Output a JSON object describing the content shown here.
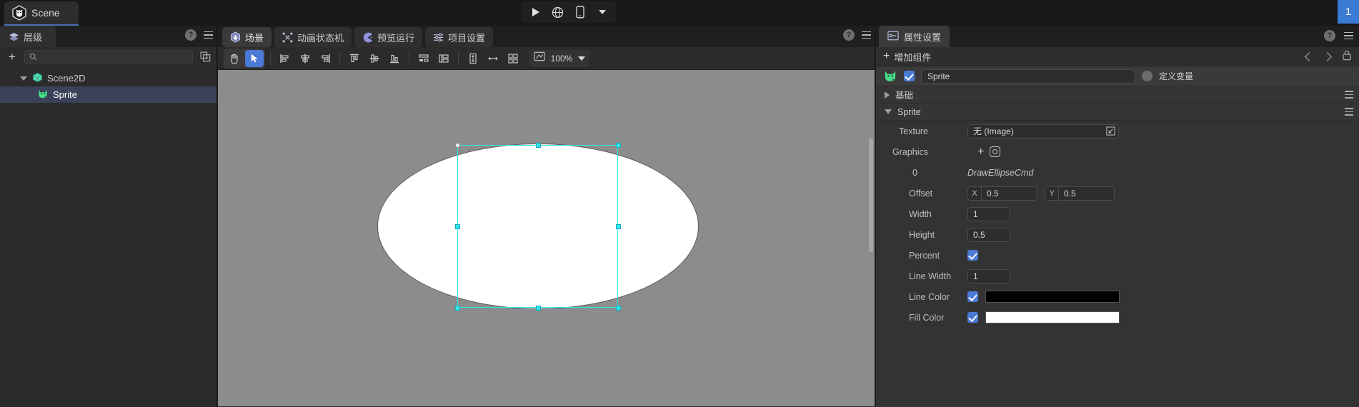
{
  "window": {
    "scene_tab_label": "Scene",
    "badge_label": "1"
  },
  "playback": {
    "play_icon": "play-icon",
    "globe_icon": "globe-icon",
    "device_icon": "device-icon",
    "dropdown_icon": "chevron-down-icon"
  },
  "hierarchy_panel": {
    "tab_label": "层级",
    "tab_icon": "layers-icon",
    "help_icon": "help-icon",
    "menu_icon": "hamburger-icon",
    "add_icon": "plus-icon",
    "search_icon": "search-icon",
    "search_value": "",
    "search_placeholder": "",
    "duplicate_icon": "duplicate-icon",
    "tree": [
      {
        "label": "Scene2D",
        "icon": "cube-icon",
        "expanded": true,
        "selected": false
      },
      {
        "label": "Sprite",
        "icon": "sprite-cat-icon",
        "expanded": false,
        "selected": true
      }
    ]
  },
  "center_panel": {
    "tabs": [
      {
        "label": "场景",
        "icon": "scene-icon",
        "active": true
      },
      {
        "label": "动画状态机",
        "icon": "state-machine-icon",
        "active": false
      },
      {
        "label": "预览运行",
        "icon": "preview-run-icon",
        "active": false
      },
      {
        "label": "项目设置",
        "icon": "project-settings-icon",
        "active": false
      }
    ],
    "help_icon": "help-icon",
    "menu_icon": "hamburger-icon",
    "toolbar": {
      "hand_tool": "hand-icon",
      "select_tool": "cursor-icon",
      "align_left": "align-left-icon",
      "align_center_h": "align-center-horizontal-icon",
      "align_right": "align-right-icon",
      "align_top": "align-top-icon",
      "align_middle_v": "align-middle-vertical-icon",
      "align_bottom": "align-bottom-icon",
      "distribute_h": "distribute-horizontal-icon",
      "distribute_v": "distribute-vertical-icon",
      "stretch_v": "stretch-vertical-icon",
      "stretch_h": "stretch-horizontal-icon",
      "grid": "grid-icon",
      "zoom_icon": "zoom-fit-icon",
      "zoom_value": "100%",
      "zoom_dropdown": "chevron-down-icon"
    }
  },
  "properties_panel": {
    "tab_label": "属性设置",
    "tab_icon": "properties-icon",
    "help_icon": "help-icon",
    "menu_icon": "hamburger-icon",
    "add_component_label": "增加组件",
    "add_component_icon": "plus-icon",
    "nav_prev_icon": "chevron-left-icon",
    "nav_next_icon": "chevron-right-icon",
    "lock_icon": "lock-icon",
    "component": {
      "icon": "sprite-cat-icon",
      "enabled": true,
      "name": "Sprite",
      "define_var_label": "定义变量",
      "define_var_checked": false
    },
    "sections": [
      {
        "label": "基础",
        "expanded": false
      },
      {
        "label": "Sprite",
        "expanded": true
      }
    ],
    "rows": {
      "texture_label": "Texture",
      "texture_value": "无 (Image)",
      "texture_picker_icon": "picker-icon",
      "graphics_label": "Graphics",
      "graphics_add_icon": "plus-icon",
      "graphics_target_icon": "target-icon",
      "item_index": "0",
      "item_type": "DrawEllipseCmd",
      "offset_label": "Offset",
      "offset_x_tag": "X",
      "offset_x": "0.5",
      "offset_y_tag": "Y",
      "offset_y": "0.5",
      "width_label": "Width",
      "width_value": "1",
      "height_label": "Height",
      "height_value": "0.5",
      "percent_label": "Percent",
      "percent_checked": true,
      "line_width_label": "Line Width",
      "line_width_value": "1",
      "line_color_label": "Line Color",
      "line_color_checked": true,
      "line_color_value": "#000000",
      "fill_color_label": "Fill Color",
      "fill_color_checked": true,
      "fill_color_value": "#ffffff"
    }
  },
  "colors": {
    "accent_blue": "#4a7ad6",
    "selection_cyan": "#2ee6f0",
    "panel_bg": "#2b2b2b",
    "canvas_bg": "#8c8c8c",
    "sprite_green": "#46e08c"
  }
}
